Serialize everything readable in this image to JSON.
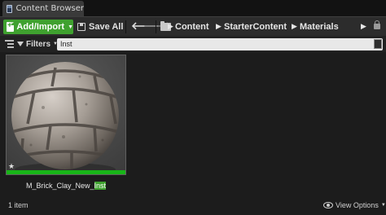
{
  "window": {
    "tab_title": "Content Browser"
  },
  "toolbar": {
    "add_import_label": "Add/Import",
    "save_all_label": "Save All"
  },
  "breadcrumb": {
    "items": [
      "Content",
      "StarterContent",
      "Materials"
    ]
  },
  "filter_bar": {
    "filters_label": "Filters",
    "search_value": "Inst"
  },
  "assets": [
    {
      "name_prefix": "M_Brick_Clay_New_",
      "name_match": "Inst"
    }
  ],
  "status": {
    "item_count": "1 item",
    "view_options_label": "View Options"
  },
  "colors": {
    "accent_green": "#3fa12f",
    "thumbnail_bar": "#18b518"
  },
  "icons": [
    "content-browser-tab-icon",
    "add-file-icon",
    "save-icon",
    "back-arrow-icon",
    "forward-arrow-icon",
    "folder-icon",
    "lock-icon",
    "sources-panel-icon",
    "filter-funnel-icon",
    "save-search-icon",
    "favorite-star-icon",
    "eye-icon"
  ]
}
